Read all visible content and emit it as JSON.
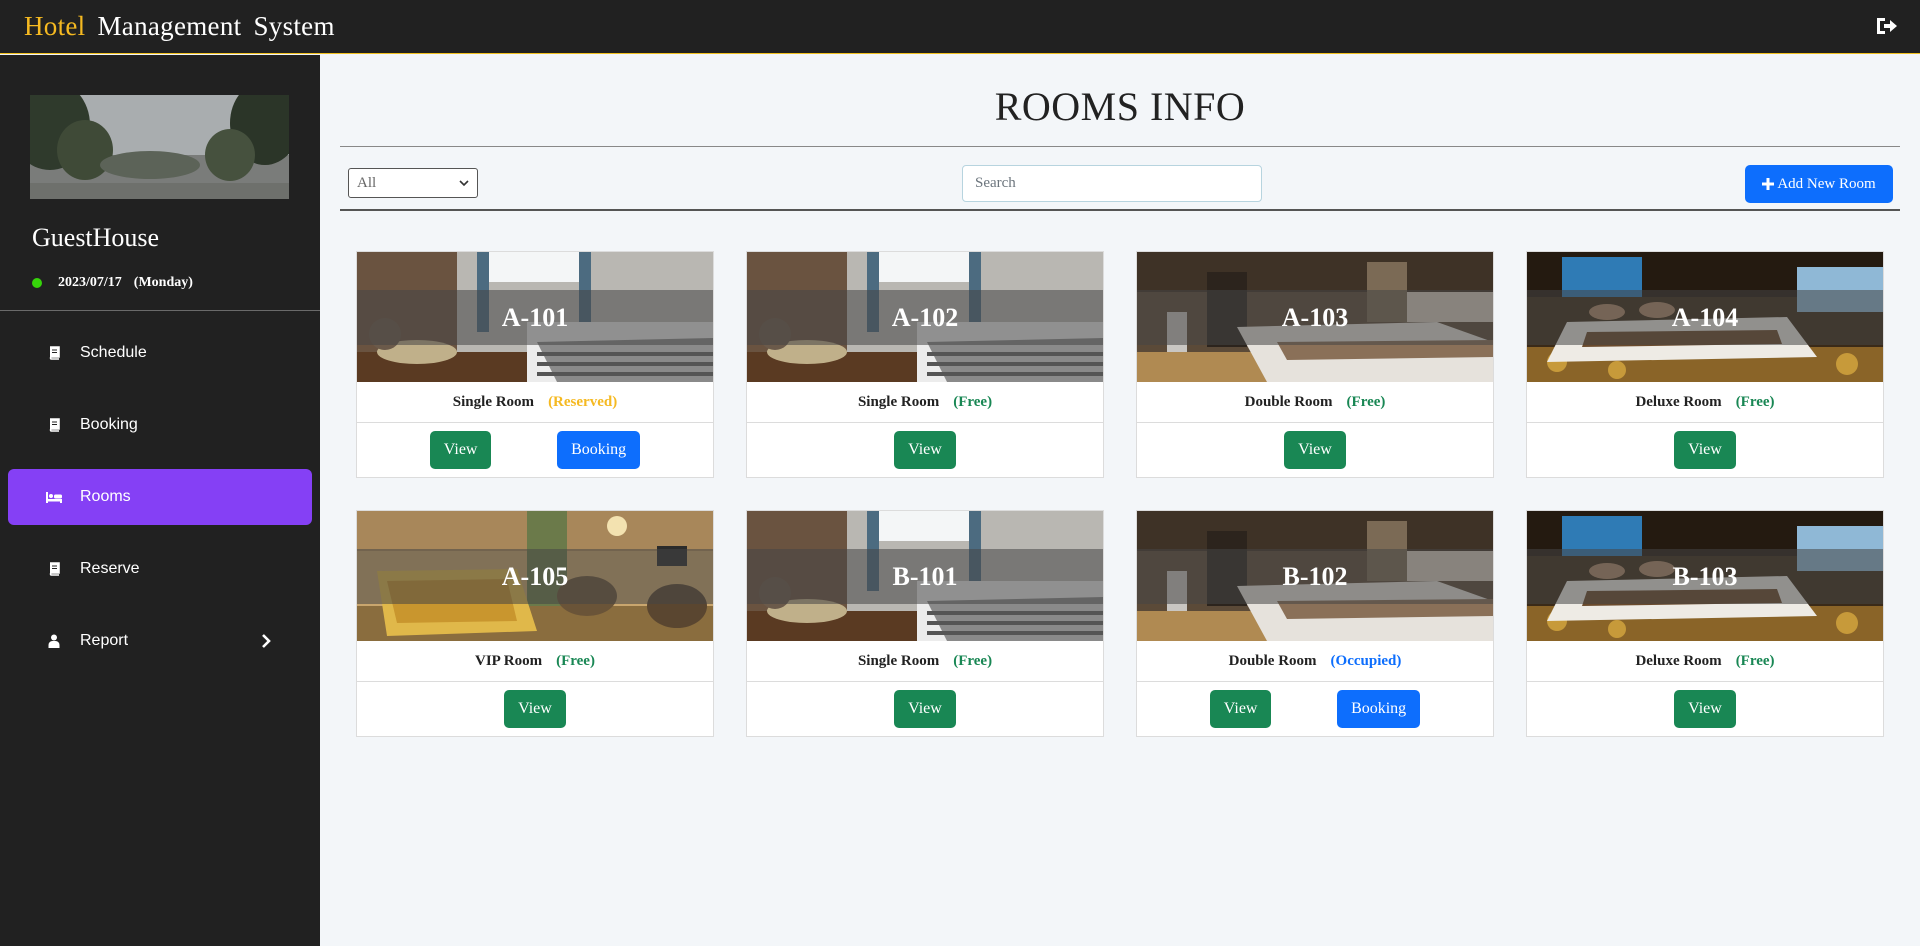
{
  "header": {
    "brand_word1": "Hotel",
    "brand_word2": "Management",
    "brand_word3": "System",
    "logout_icon": "sign-out-icon"
  },
  "sidebar": {
    "hotel_name": "GuestHouse",
    "date": "2023/07/17",
    "day": "(Monday)",
    "status_color": "#36d40a",
    "items": [
      {
        "label": "Schedule",
        "icon": "book-icon",
        "active": false
      },
      {
        "label": "Booking",
        "icon": "book-icon",
        "active": false
      },
      {
        "label": "Rooms",
        "icon": "bed-icon",
        "active": true
      },
      {
        "label": "Reserve",
        "icon": "book-icon",
        "active": false
      },
      {
        "label": "Report",
        "icon": "user-icon",
        "active": false,
        "has_submenu": true
      }
    ]
  },
  "main": {
    "title": "ROOMS INFO",
    "filter_selected": "All",
    "search_placeholder": "Search",
    "add_button_label": "Add New Room",
    "view_label": "View",
    "booking_label": "Booking",
    "rooms": [
      {
        "code": "A-101",
        "type": "Single Room",
        "status": "(Reserved)",
        "status_kind": "reserved",
        "has_booking": true,
        "photo": "single"
      },
      {
        "code": "A-102",
        "type": "Single Room",
        "status": "(Free)",
        "status_kind": "free",
        "has_booking": false,
        "photo": "single"
      },
      {
        "code": "A-103",
        "type": "Double Room",
        "status": "(Free)",
        "status_kind": "free",
        "has_booking": false,
        "photo": "double"
      },
      {
        "code": "A-104",
        "type": "Deluxe Room",
        "status": "(Free)",
        "status_kind": "free",
        "has_booking": false,
        "photo": "deluxe"
      },
      {
        "code": "A-105",
        "type": "VIP Room",
        "status": "(Free)",
        "status_kind": "free",
        "has_booking": false,
        "photo": "vip"
      },
      {
        "code": "B-101",
        "type": "Single Room",
        "status": "(Free)",
        "status_kind": "free",
        "has_booking": false,
        "photo": "single"
      },
      {
        "code": "B-102",
        "type": "Double Room",
        "status": "(Occupied)",
        "status_kind": "occupied",
        "has_booking": true,
        "photo": "double"
      },
      {
        "code": "B-103",
        "type": "Deluxe Room",
        "status": "(Free)",
        "status_kind": "free",
        "has_booking": false,
        "photo": "deluxe"
      }
    ]
  },
  "colors": {
    "accent_purple": "#8540f5",
    "brand_yellow": "#f5b921",
    "success_green": "#198754",
    "primary_blue": "#0d6efd",
    "dark_bg": "#212121"
  }
}
